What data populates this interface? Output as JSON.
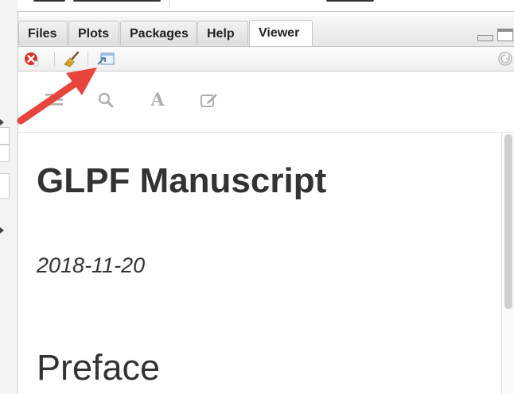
{
  "tabs": [
    {
      "label": "Files",
      "active": false
    },
    {
      "label": "Plots",
      "active": false
    },
    {
      "label": "Packages",
      "active": false
    },
    {
      "label": "Help",
      "active": false
    },
    {
      "label": "Viewer",
      "active": true
    }
  ],
  "toolbar": {
    "icons": [
      "clear-current-icon",
      "clear-all-broom-icon",
      "show-in-new-window-icon",
      "refresh-icon"
    ]
  },
  "booknav": {
    "icons": [
      "toc-menu-icon",
      "search-icon",
      "font-settings-icon",
      "edit-icon"
    ]
  },
  "document": {
    "title": "GLPF Manuscript",
    "date": "2018-11-20",
    "section": "Preface"
  },
  "annotation": {
    "arrow_color": "#e8453c",
    "points_to": "show-in-new-window-icon"
  },
  "colors": {
    "text": "#333333",
    "clear_red": "#d9302a",
    "nav_icon": "#b0b0b0"
  }
}
